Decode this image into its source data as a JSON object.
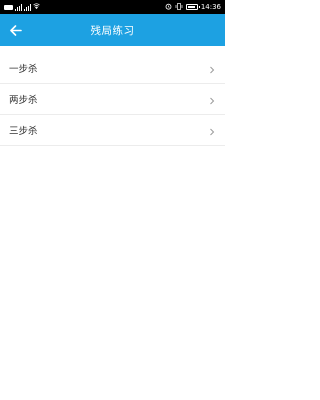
{
  "status_bar": {
    "left_text": "",
    "time": "14:36",
    "battery_level": 0.9
  },
  "app_bar": {
    "title": "残局练习",
    "back_icon": "arrow-left-icon",
    "background_color": "#1da1e2"
  },
  "list": {
    "items": [
      {
        "label": "一步杀",
        "icon": "chevron-right-icon"
      },
      {
        "label": "两步杀",
        "icon": "chevron-right-icon"
      },
      {
        "label": "三步杀",
        "icon": "chevron-right-icon"
      }
    ]
  }
}
